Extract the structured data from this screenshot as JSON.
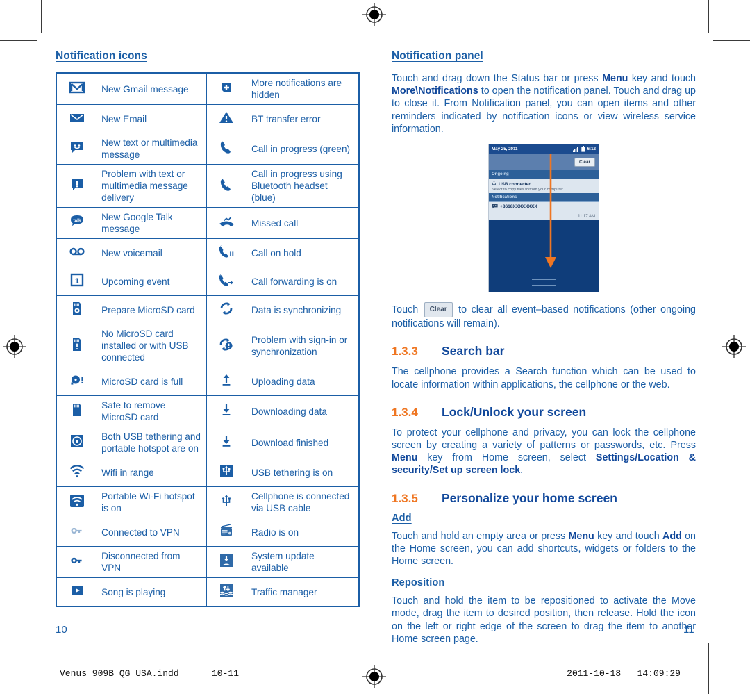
{
  "document": {
    "left_page_number": "10",
    "right_page_number": "11",
    "footer_file": "Venus_909B_QG_USA.indd",
    "footer_pages": "10-11",
    "footer_date": "2011-10-18",
    "footer_time": "14:09:29"
  },
  "colors": {
    "body_blue": "#1b5ea6",
    "heading_blue": "#11489b",
    "section_orange": "#ef7622",
    "table_border": "#1b5ea6"
  },
  "left_column": {
    "heading": "Notification icons",
    "table": {
      "rows": [
        {
          "icon_left": "gmail-icon",
          "label_left": "New Gmail message",
          "icon_right": "more-notifications-icon",
          "label_right": "More notifications are hidden"
        },
        {
          "icon_left": "email-icon",
          "label_left": "New Email",
          "icon_right": "bt-transfer-error-icon",
          "label_right": "BT transfer error"
        },
        {
          "icon_left": "sms-message-icon",
          "label_left": "New text or multimedia message",
          "icon_right": "call-in-progress-icon",
          "label_right": "Call in progress (green)"
        },
        {
          "icon_left": "sms-problem-icon",
          "label_left": "Problem with text or multimedia message delivery",
          "icon_right": "call-bluetooth-icon",
          "label_right": "Call in progress using Bluetooth headset (blue)"
        },
        {
          "icon_left": "google-talk-icon",
          "label_left": "New Google Talk message",
          "icon_right": "missed-call-icon",
          "label_right": "Missed call"
        },
        {
          "icon_left": "voicemail-icon",
          "label_left": "New voicemail",
          "icon_right": "call-on-hold-icon",
          "label_right": "Call on hold"
        },
        {
          "icon_left": "calendar-event-icon",
          "label_left": "Upcoming event",
          "icon_right": "call-forwarding-icon",
          "label_right": "Call forwarding is on"
        },
        {
          "icon_left": "microsd-prepare-icon",
          "label_left": "Prepare MicroSD card",
          "icon_right": "sync-icon",
          "label_right": "Data is synchronizing"
        },
        {
          "icon_left": "microsd-missing-icon",
          "label_left": "No MicroSD card installed or with USB connected",
          "icon_right": "sync-problem-icon",
          "label_right": "Problem with sign-in or synchronization"
        },
        {
          "icon_left": "microsd-full-icon",
          "label_left": "MicroSD card is full",
          "icon_right": "upload-icon",
          "label_right": "Uploading data"
        },
        {
          "icon_left": "microsd-safe-remove-icon",
          "label_left": "Safe to remove MicroSD card",
          "icon_right": "download-icon",
          "label_right": "Downloading data"
        },
        {
          "icon_left": "usb-tether-hotspot-icon",
          "label_left": "Both USB tethering and portable hotspot are on",
          "icon_right": "download-finished-icon",
          "label_right": "Download finished"
        },
        {
          "icon_left": "wifi-in-range-icon",
          "label_left": "Wifi in range",
          "icon_right": "usb-tethering-on-icon",
          "label_right": "USB tethering is on"
        },
        {
          "icon_left": "portable-hotspot-icon",
          "label_left": "Portable Wi-Fi hotspot is on",
          "icon_right": "usb-cable-icon",
          "label_right": "Cellphone is connected via USB cable"
        },
        {
          "icon_left": "vpn-connected-icon",
          "label_left": "Connected to VPN",
          "icon_right": "radio-on-icon",
          "label_right": "Radio is on"
        },
        {
          "icon_left": "vpn-disconnected-icon",
          "label_left": "Disconnected from VPN",
          "icon_right": "system-update-icon",
          "label_right": "System update available"
        },
        {
          "icon_left": "music-play-icon",
          "label_left": "Song is playing",
          "icon_right": "traffic-manager-icon",
          "label_right": "Traffic manager"
        }
      ]
    }
  },
  "right_column": {
    "notification_panel": {
      "heading": "Notification panel",
      "paragraph_parts": [
        {
          "text": "Touch and drag down the Status bar or press ",
          "bold": false
        },
        {
          "text": "Menu",
          "bold": true
        },
        {
          "text": " key and touch ",
          "bold": false
        },
        {
          "text": "More\\Notifications",
          "bold": true
        },
        {
          "text": " to open the notification panel. Touch and drag up to close it. From Notification panel, you can open items and other reminders indicated by notification icons or view wireless service information.",
          "bold": false
        }
      ]
    },
    "phone_screenshot": {
      "status_date": "May 25, 2011",
      "status_time": "6:12",
      "signal_icon": "signal-bars-icon",
      "battery_icon": "battery-icon",
      "clear_button": "Clear",
      "ongoing_header": "Ongoing",
      "ongoing_item_icon": "usb-icon",
      "ongoing_item_title": "USB connected",
      "ongoing_item_subtitle": "Select to copy files to/from your computer.",
      "notifications_header": "Notifications",
      "notification_icon": "sms-message-icon",
      "notification_number": "+8618XXXXXXXX",
      "notification_time": "11:17 AM",
      "drag_arrow": "down-arrow-annotation",
      "arrow_color": "#ef7622"
    },
    "clear_paragraph": {
      "before": "Touch ",
      "chip": "Clear",
      "after": " to clear all event–based notifications (other ongoing notifications will remain)."
    },
    "sections": [
      {
        "number": "1.3.3",
        "title": "Search bar",
        "paragraphs": [
          "The cellphone provides a Search function which can be used to locate information within applications, the cellphone or the web."
        ]
      },
      {
        "number": "1.3.4",
        "title": "Lock/Unlock your screen",
        "paragraph_parts": [
          {
            "text": "To protect your cellphone and privacy, you can lock the cellphone screen by creating a variety of patterns or passwords, etc. Press ",
            "bold": false
          },
          {
            "text": "Menu",
            "bold": true
          },
          {
            "text": " key from Home screen, select ",
            "bold": false
          },
          {
            "text": "Settings/Location & security/Set up screen lock",
            "bold": true
          },
          {
            "text": ".",
            "bold": false
          }
        ]
      },
      {
        "number": "1.3.5",
        "title": "Personalize your home screen",
        "subsections": [
          {
            "heading": "Add",
            "paragraph_parts": [
              {
                "text": "Touch and hold an empty area or press ",
                "bold": false
              },
              {
                "text": "Menu",
                "bold": true
              },
              {
                "text": " key and touch ",
                "bold": false
              },
              {
                "text": "Add",
                "bold": true
              },
              {
                "text": " on the Home screen, you can add shortcuts, widgets or folders to the Home screen.",
                "bold": false
              }
            ]
          },
          {
            "heading": "Reposition ",
            "paragraph_parts": [
              {
                "text": "Touch and hold the item to be repositioned to activate the Move mode, drag the item to desired position, then release. Hold the icon on the left or right edge of the screen to drag the item to another Home screen page.",
                "bold": false
              }
            ]
          }
        ]
      }
    ]
  }
}
